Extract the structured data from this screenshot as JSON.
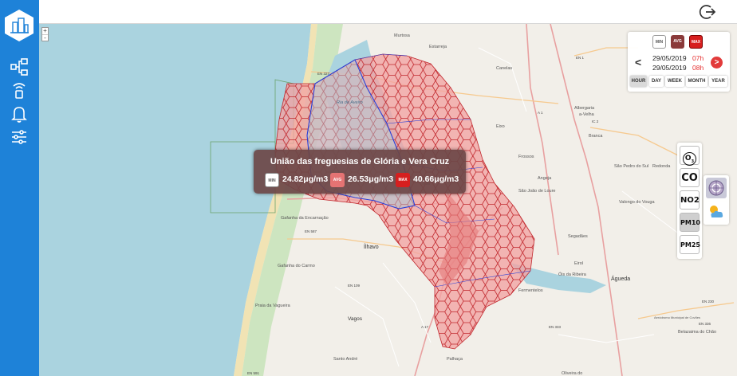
{
  "sidebar": {
    "logo_icon": "city-logo-icon",
    "items": [
      {
        "icon": "network-icon"
      },
      {
        "icon": "sensor-icon"
      },
      {
        "icon": "bell-icon"
      },
      {
        "icon": "sliders-icon"
      }
    ]
  },
  "header": {
    "logout_icon": "logout-icon"
  },
  "map": {
    "zoom_in": "+",
    "zoom_out": "-",
    "labels": {
      "murtosa": "Murtosa",
      "estarreja": "Estarreja",
      "canelas": "Canelas",
      "albergaria": "Albergaria",
      "a_velha": "a-Velha",
      "ria_aveiro": "Ria de Aveiro",
      "eixo": "Eixo",
      "frossos": "Frossos",
      "sao_joao": "São João de Loure",
      "angeja": "Angeja",
      "branca": "Branca",
      "redonda": "Redonda",
      "sao_pedro": "São Pedro do Sul",
      "valongo": "Valongo do Vouga",
      "segadaes": "Segadães",
      "gafanha_enc": "Gafanha da Encarnação",
      "gafanha_carmo": "Gafanha do Carmo",
      "ilhavo": "Ílhavo",
      "praia_vagueira": "Praia da Vagueira",
      "vagos": "Vagos",
      "santo_andre": "Santo André",
      "palhaca": "Palhaça",
      "oliveira": "Oliveira do",
      "agueda": "Águeda",
      "belazaima": "Belazaima do Chão",
      "aerodromo": "Aeródromo Municipal de Covões",
      "fermentelos": "Fermentelos",
      "eirol": "Eirol",
      "ois_ribeira": "Óis da Ribeira",
      "en327": "EN 327",
      "en1": "EN 1",
      "a1": "A 1",
      "a17": "A 17",
      "a25": "A 25",
      "ic2": "IC 2",
      "en587": "EN 587",
      "en109": "EN 109",
      "en333": "EN 333",
      "en336": "EN 336",
      "en230": "EN 230",
      "en591": "EN 591"
    }
  },
  "time_panel": {
    "stats": {
      "min": "MIN",
      "avg": "AVG",
      "max": "MAX"
    },
    "prev": "<",
    "next": ">",
    "rows": [
      {
        "date": "29/05/2019",
        "hour": "07h"
      },
      {
        "date": "29/05/2019",
        "hour": "08h"
      }
    ],
    "periods": [
      {
        "label": "HOUR",
        "active": true
      },
      {
        "label": "DAY",
        "active": false
      },
      {
        "label": "WEEK",
        "active": false
      },
      {
        "label": "MONTH",
        "active": false
      },
      {
        "label": "YEAR",
        "active": false
      }
    ]
  },
  "pollutants": [
    {
      "label": "O",
      "sub": "3",
      "active": false
    },
    {
      "label": "CO",
      "active": false
    },
    {
      "label": "NO2",
      "active": false
    },
    {
      "label": "PM10",
      "active": true
    },
    {
      "label": "PM25",
      "active": false
    }
  ],
  "layers": [
    {
      "icon": "traffic-layer-icon"
    },
    {
      "icon": "weather-icon"
    }
  ],
  "tooltip": {
    "title": "União das freguesias de Glória e Vera Cruz",
    "min_label": "MIN",
    "min": "24.82μg/m3",
    "avg_label": "AVG",
    "avg": "26.53μg/m3",
    "max_label": "MAX",
    "max": "40.66μg/m3"
  },
  "colors": {
    "sidebar": "#1e82d8",
    "sea": "#aad3df",
    "land": "#f2efe9",
    "hex_fill": "#f2a3a3",
    "hex_stroke": "#c1272d",
    "boundary": "#2a3fd8",
    "accent_red": "#e53030"
  }
}
